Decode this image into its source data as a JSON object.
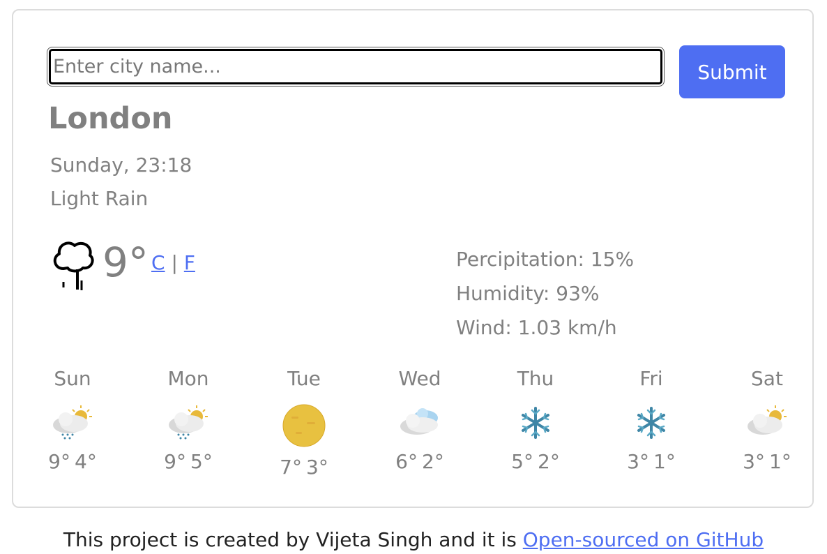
{
  "search": {
    "placeholder": "Enter city name...",
    "value": ""
  },
  "submit_label": "Submit",
  "current": {
    "city": "London",
    "datetime": "Sunday, 23:18",
    "description": "Light Rain",
    "icon": "rain-cloud-outline-icon",
    "temperature": "9°",
    "unit_c": "C",
    "unit_separator": "|",
    "unit_f": "F"
  },
  "details": {
    "precipitation": "Percipitation: 15%",
    "humidity": "Humidity: 93%",
    "wind": "Wind: 1.03 km/h"
  },
  "forecast": [
    {
      "day": "Sun",
      "icon": "sun-cloud-rain-icon",
      "high": "9°",
      "low": "4°"
    },
    {
      "day": "Mon",
      "icon": "sun-cloud-rain-icon",
      "high": "9°",
      "low": "5°"
    },
    {
      "day": "Tue",
      "icon": "sun-icon",
      "high": "7°",
      "low": "3°"
    },
    {
      "day": "Wed",
      "icon": "cloud-icon",
      "high": "6°",
      "low": "2°"
    },
    {
      "day": "Thu",
      "icon": "snowflake-icon",
      "high": "5°",
      "low": "2°"
    },
    {
      "day": "Fri",
      "icon": "snowflake-icon",
      "high": "3°",
      "low": "1°"
    },
    {
      "day": "Sat",
      "icon": "sun-cloud-icon",
      "high": "3°",
      "low": "1°"
    }
  ],
  "footer": {
    "text": "This project is created by Vijeta Singh and it is ",
    "link": "Open-sourced on GitHub"
  },
  "colors": {
    "accent": "#4e6ef2",
    "text": "#808080",
    "sun": "#e8b93a",
    "snow": "#3f86a6"
  }
}
